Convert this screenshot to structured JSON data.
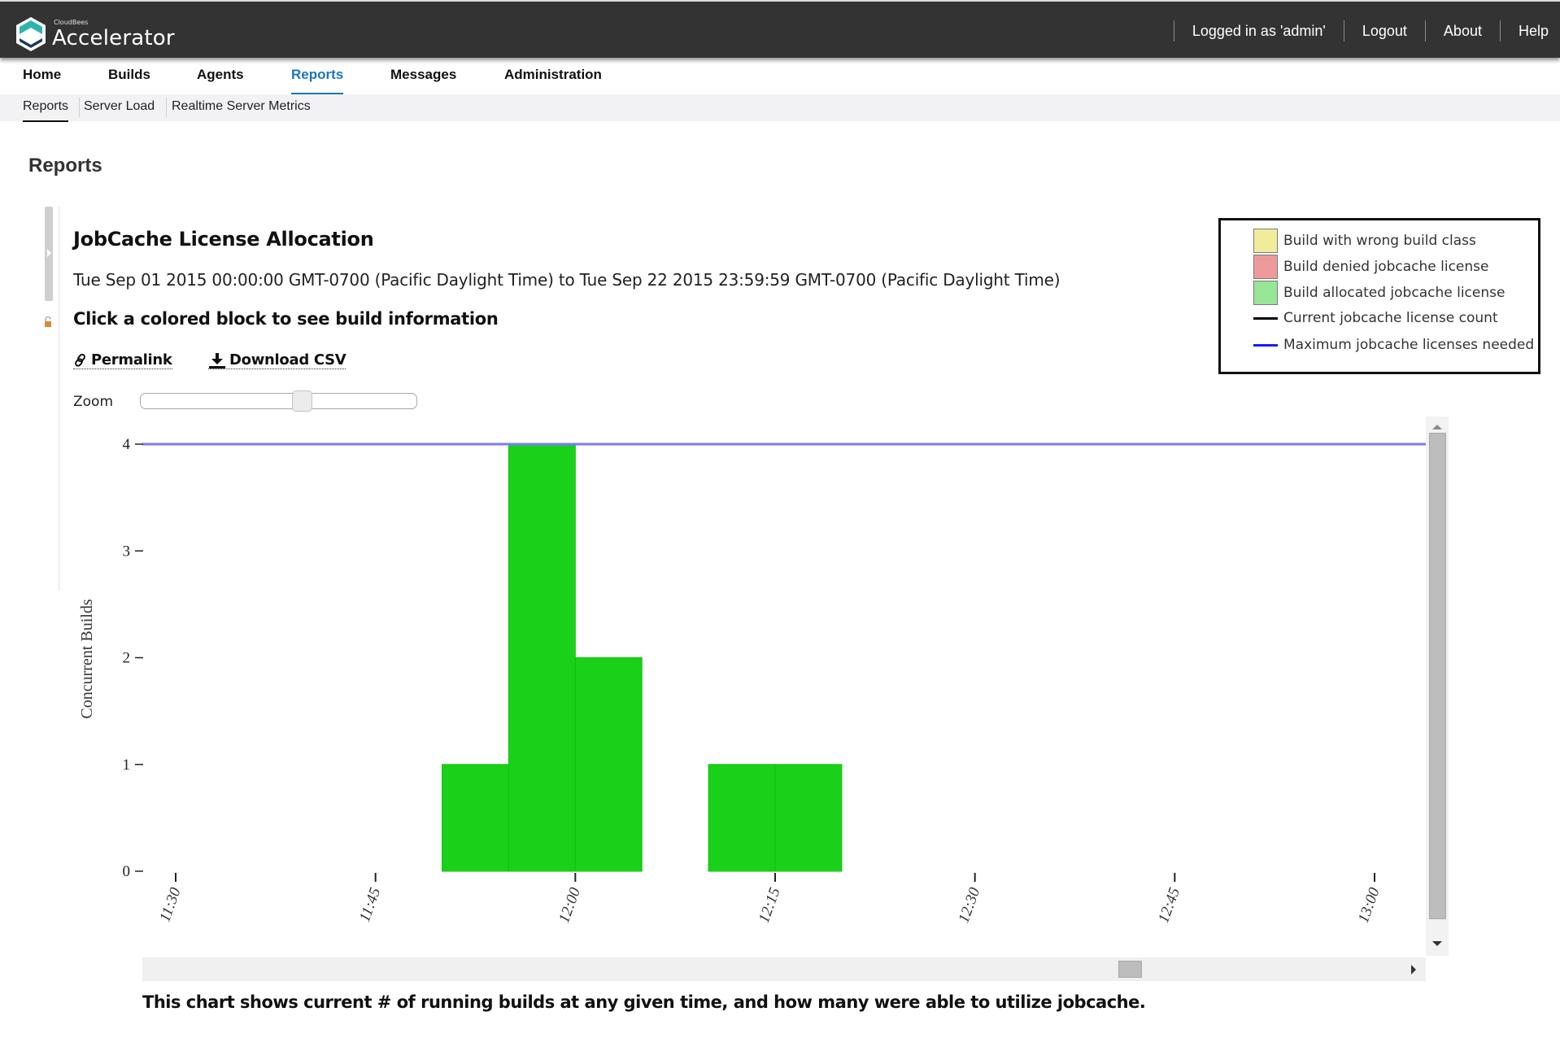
{
  "header": {
    "brand_small": "CloudBees",
    "brand": "Accelerator",
    "logged_in": "Logged in as 'admin'",
    "logout": "Logout",
    "about": "About",
    "help": "Help"
  },
  "main_nav": [
    {
      "label": "Home",
      "active": false
    },
    {
      "label": "Builds",
      "active": false
    },
    {
      "label": "Agents",
      "active": false
    },
    {
      "label": "Reports",
      "active": true
    },
    {
      "label": "Messages",
      "active": false
    },
    {
      "label": "Administration",
      "active": false
    }
  ],
  "sub_nav": [
    {
      "label": "Reports",
      "active": true
    },
    {
      "label": "Server Load",
      "active": false
    },
    {
      "label": "Realtime Server Metrics",
      "active": false
    }
  ],
  "page": {
    "title": "Reports"
  },
  "report": {
    "title": "JobCache License Allocation",
    "date_range": "Tue Sep 01 2015 00:00:00 GMT-0700 (Pacific Daylight Time) to Tue Sep 22 2015 23:59:59 GMT-0700 (Pacific Daylight Time)",
    "instruction": "Click a colored block to see build information",
    "permalink": "Permalink",
    "download_csv": "Download CSV",
    "zoom_label": "Zoom",
    "zoom_level": 0.6,
    "footnote": "This chart shows current # of running builds at any given time, and how many were able to utilize jobcache."
  },
  "legend": [
    {
      "type": "swatch",
      "label": "Build with wrong build class",
      "color": "#f0ec9c"
    },
    {
      "type": "swatch",
      "label": "Build denied jobcache license",
      "color": "#ee9a9a"
    },
    {
      "type": "swatch",
      "label": "Build allocated jobcache license",
      "color": "#98e698"
    },
    {
      "type": "line",
      "label": "Current jobcache license count",
      "color": "#000000"
    },
    {
      "type": "line",
      "label": "Maximum jobcache licenses needed",
      "color": "#1a1aff"
    }
  ],
  "chart_data": {
    "type": "bar",
    "title": "JobCache License Allocation",
    "xlabel": "",
    "ylabel": "Concurrent Builds",
    "ylim": [
      0,
      4
    ],
    "yticks": [
      0,
      1,
      2,
      3,
      4
    ],
    "xlim_minutes": [
      690,
      780
    ],
    "xticks": [
      {
        "label": "11:30",
        "minute": 690
      },
      {
        "label": "11:45",
        "minute": 705
      },
      {
        "label": "12:00",
        "minute": 720
      },
      {
        "label": "12:15",
        "minute": 735
      },
      {
        "label": "12:30",
        "minute": 750
      },
      {
        "label": "12:45",
        "minute": 765
      },
      {
        "label": "13:00",
        "minute": 780
      }
    ],
    "series": [
      {
        "name": "Build allocated jobcache license",
        "color": "#1ad11a",
        "blocks": [
          {
            "start": "11:50",
            "end": "11:55",
            "value": 1
          },
          {
            "start": "11:55",
            "end": "12:00",
            "value": 4
          },
          {
            "start": "12:00",
            "end": "12:05",
            "value": 2
          },
          {
            "start": "12:10",
            "end": "12:15",
            "value": 1
          },
          {
            "start": "12:15",
            "end": "12:20",
            "value": 1
          }
        ]
      },
      {
        "name": "Maximum jobcache licenses needed",
        "color": "#7a7aff",
        "line_value": 4
      }
    ],
    "grid": false,
    "legend_position": "top-right"
  }
}
